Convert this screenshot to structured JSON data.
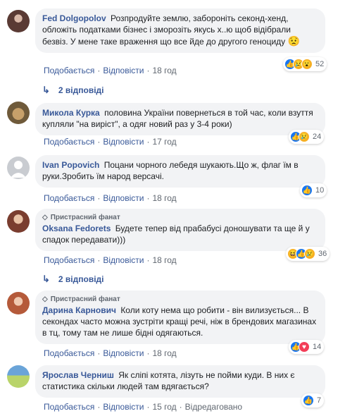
{
  "comments": [
    {
      "author": "Fed Dolgopolov",
      "text": "Розпродуйте землю, забороніть секонд-хенд, обложіть податками бізнес і зморозіть якусь х..ю щоб відібрали безвіз. У мене таке враження що все йде до другого геноциду",
      "emoji": "😟",
      "like_label": "Подобається",
      "reply_label": "Відповісти",
      "time": "18 год",
      "reaction_count": "52",
      "replies_label": "2 відповіді"
    },
    {
      "author": "Микола Курка",
      "text": "половина України повернеться в той час, коли взуття купляли \"на виріст\", а одяг новий раз у 3-4 роки)",
      "like_label": "Подобається",
      "reply_label": "Відповісти",
      "time": "17 год",
      "reaction_count": "24"
    },
    {
      "author": "Ivan Popovich",
      "text": "Поцани чорного лебедя шукають.Що ж, флаг їм в руки.Зробить їм народ версачі.",
      "like_label": "Подобається",
      "reply_label": "Відповісти",
      "time": "18 год",
      "reaction_count": "10"
    },
    {
      "badge": "Пристрасний фанат",
      "author": "Oksana Fedorets",
      "text": "Будете тепер від прабабусі доношувати та ще й у спадок передавати)))",
      "like_label": "Подобається",
      "reply_label": "Відповісти",
      "time": "18 год",
      "reaction_count": "36",
      "replies_label": "2 відповіді"
    },
    {
      "badge": "Пристрасний фанат",
      "author": "Дарина Карнович",
      "text": "Коли коту нема що робити - він вилизується... В секондах часто можна зустріти кращі речі, ніж в брендових магазинах в тц, тому там не лише бідні одягаються.",
      "like_label": "Подобається",
      "reply_label": "Відповісти",
      "time": "18 год",
      "reaction_count": "14"
    },
    {
      "author": "Ярослав Черниш",
      "text": "Як сліпі котята, лізуть не пойми куди. В них є статистика скільки людей там вдягається?",
      "like_label": "Подобається",
      "reply_label": "Відповісти",
      "time": "15 год",
      "edited": "Відредаговано",
      "reaction_count": "7"
    }
  ],
  "separator": "·",
  "colors": {
    "link": "#385898",
    "bubble": "#f2f3f5",
    "meta": "#606770",
    "like": "#1877f2",
    "love": "#f33e58",
    "sad": "#f7b125"
  }
}
